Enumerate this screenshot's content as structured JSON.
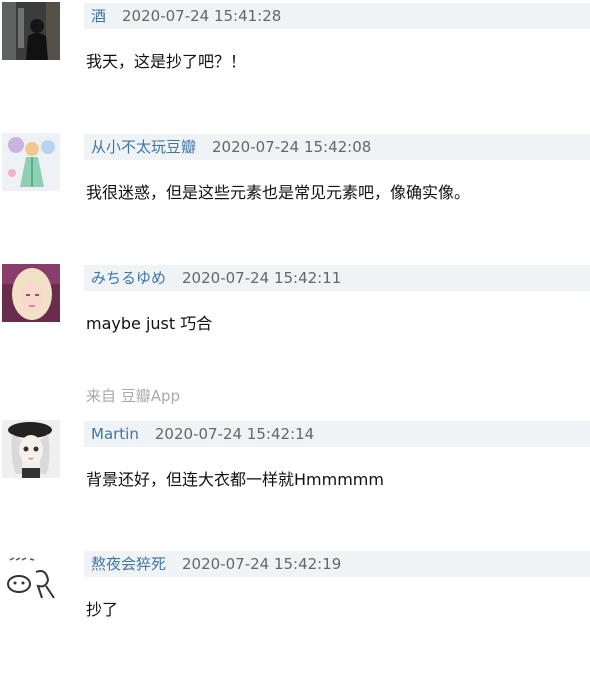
{
  "comments": [
    {
      "author": "酒",
      "time": "2020-07-24 15:41:28",
      "text": "我天，这是抄了吧？！",
      "avatar": "dark-silhouette-avatar"
    },
    {
      "author": "从小不太玩豆瓣",
      "time": "2020-07-24 15:42:08",
      "text": "我很迷惑，但是这些元素也是常见元素吧，像确实像。",
      "avatar": "fairy-figure-avatar"
    },
    {
      "author": "みちるゆめ",
      "time": "2020-07-24 15:42:11",
      "text": "maybe just 巧合",
      "source": "来自 豆瓣App",
      "avatar": "blonde-girl-avatar"
    },
    {
      "author": "Martin",
      "time": "2020-07-24 15:42:14",
      "text": "背景还好，但连大衣都一样就Hmmmmm",
      "avatar": "anime-girl-beret-avatar"
    },
    {
      "author": "熬夜会猝死",
      "time": "2020-07-24 15:42:19",
      "text": "抄了",
      "avatar": "doodle-sketch-avatar"
    }
  ],
  "colors": {
    "author": "#3e76a8",
    "meta_bg": "#f0f3f5",
    "source": "#aaaaaa"
  }
}
